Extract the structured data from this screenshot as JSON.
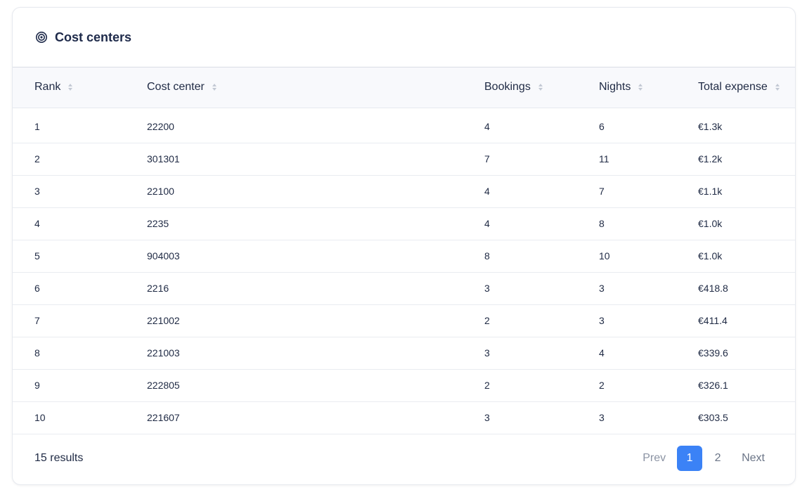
{
  "card": {
    "title": "Cost centers",
    "icon": "target-icon"
  },
  "table": {
    "columns": [
      {
        "key": "rank",
        "label": "Rank"
      },
      {
        "key": "cost_center",
        "label": "Cost center"
      },
      {
        "key": "bookings",
        "label": "Bookings"
      },
      {
        "key": "nights",
        "label": "Nights"
      },
      {
        "key": "total_expense",
        "label": "Total expense"
      }
    ],
    "rows": [
      {
        "rank": "1",
        "cost_center": "22200",
        "bookings": "4",
        "nights": "6",
        "total_expense": "€1.3k"
      },
      {
        "rank": "2",
        "cost_center": "301301",
        "bookings": "7",
        "nights": "11",
        "total_expense": "€1.2k"
      },
      {
        "rank": "3",
        "cost_center": "22100",
        "bookings": "4",
        "nights": "7",
        "total_expense": "€1.1k"
      },
      {
        "rank": "4",
        "cost_center": "2235",
        "bookings": "4",
        "nights": "8",
        "total_expense": "€1.0k"
      },
      {
        "rank": "5",
        "cost_center": "904003",
        "bookings": "8",
        "nights": "10",
        "total_expense": "€1.0k"
      },
      {
        "rank": "6",
        "cost_center": "2216",
        "bookings": "3",
        "nights": "3",
        "total_expense": "€418.8"
      },
      {
        "rank": "7",
        "cost_center": "221002",
        "bookings": "2",
        "nights": "3",
        "total_expense": "€411.4"
      },
      {
        "rank": "8",
        "cost_center": "221003",
        "bookings": "3",
        "nights": "4",
        "total_expense": "€339.6"
      },
      {
        "rank": "9",
        "cost_center": "222805",
        "bookings": "2",
        "nights": "2",
        "total_expense": "€326.1"
      },
      {
        "rank": "10",
        "cost_center": "221607",
        "bookings": "3",
        "nights": "3",
        "total_expense": "€303.5"
      }
    ]
  },
  "footer": {
    "results_text": "15 results",
    "pagination": {
      "prev_label": "Prev",
      "pages": [
        "1",
        "2"
      ],
      "current_page": "1",
      "next_label": "Next"
    }
  },
  "colors": {
    "accent": "#3b82f6",
    "header_bg": "#f8f9fc",
    "text": "#1f2a44"
  }
}
